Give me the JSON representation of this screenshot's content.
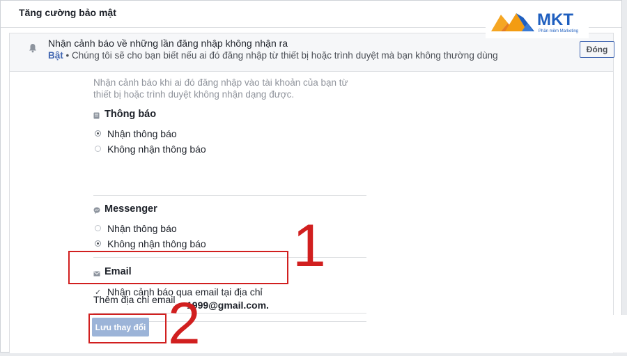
{
  "panel": {
    "title": "Tăng cường bảo mật"
  },
  "setting": {
    "title": "Nhận cảnh báo về những lần đăng nhập không nhận ra",
    "status": "Bật",
    "description": " • Chúng tôi sẽ cho bạn biết nếu ai đó đăng nhập từ thiết bị hoặc trình duyệt mà bạn không thường dùng",
    "close_label": "Đóng"
  },
  "intro": "Nhận cảnh báo khi ai đó đăng nhập vào tài khoản của bạn từ thiết bị hoặc trình duyệt không nhận dạng được.",
  "notifications": {
    "title": "Thông báo",
    "options": [
      {
        "label": "Nhận thông báo",
        "checked": true
      },
      {
        "label": "Không nhận thông báo",
        "checked": false
      }
    ]
  },
  "messenger": {
    "title": "Messenger",
    "options": [
      {
        "label": "Nhận thông báo",
        "checked": false
      },
      {
        "label": "Không nhận thông báo",
        "checked": true
      }
    ]
  },
  "email": {
    "title": "Email",
    "checkbox_label": "Nhận cảnh báo qua email tại địa chỉ",
    "address_visible": "1999@gmail.com."
  },
  "add_email": "Thêm địa chỉ email",
  "save_label": "Lưu thay đổi",
  "annotations": {
    "one": "1",
    "two": "2",
    "color": "#d11f1f"
  },
  "logo": {
    "text": "MKT",
    "subtitle": "Phần mềm Marketing"
  },
  "colors": {
    "accent": "#4267b2",
    "button_disabled": "#9cb4d8"
  }
}
